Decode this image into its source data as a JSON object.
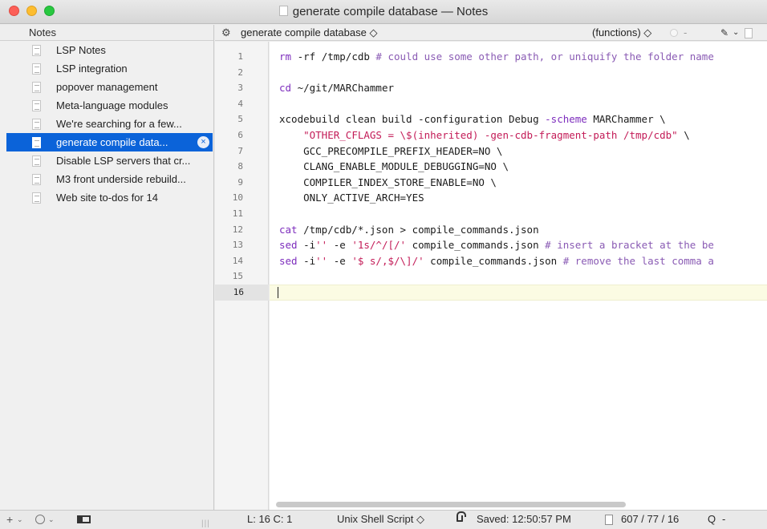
{
  "window": {
    "title": "generate compile database — Notes"
  },
  "sidebar": {
    "header": "Notes",
    "items": [
      {
        "label": "LSP Notes",
        "icon": "formatted-doc-icon"
      },
      {
        "label": "LSP integration",
        "icon": "document-icon"
      },
      {
        "label": "popover management",
        "icon": "document-icon"
      },
      {
        "label": "Meta-language modules",
        "icon": "document-icon"
      },
      {
        "label": "We're searching for a few...",
        "icon": "formatted-doc-icon"
      },
      {
        "label": "generate compile data...",
        "icon": "document-icon",
        "selected": true
      },
      {
        "label": "Disable LSP servers that cr...",
        "icon": "document-icon"
      },
      {
        "label": "M3 front underside rebuild...",
        "icon": "document-icon"
      },
      {
        "label": "Web site to-dos for 14",
        "icon": "document-icon"
      }
    ],
    "selected_clear_icon": "×"
  },
  "editor": {
    "header": {
      "document_menu": "generate compile database ◇",
      "functions_menu": "(functions) ◇",
      "dash": "-"
    },
    "line_numbers": [
      "1",
      "2",
      "3",
      "4",
      "5",
      "6",
      "7",
      "8",
      "9",
      "10",
      "11",
      "12",
      "13",
      "14",
      "15",
      "16"
    ],
    "current_line": 16,
    "code": [
      [
        {
          "t": "kw",
          "v": "rm"
        },
        {
          "t": "",
          "v": " -rf /tmp/cdb "
        },
        {
          "t": "cmt",
          "v": "# could use some other path, or uniquify the folder name"
        }
      ],
      [],
      [
        {
          "t": "kw",
          "v": "cd"
        },
        {
          "t": "",
          "v": " ~/git/MARChammer"
        }
      ],
      [],
      [
        {
          "t": "",
          "v": "xcodebuild clean build -configuration Debug "
        },
        {
          "t": "kw",
          "v": "-scheme"
        },
        {
          "t": "",
          "v": " MARChammer \\"
        }
      ],
      [
        {
          "t": "",
          "v": "    "
        },
        {
          "t": "str",
          "v": "\"OTHER_CFLAGS = \\$(inherited) -gen-cdb-fragment-path /tmp/cdb\""
        },
        {
          "t": "",
          "v": " \\"
        }
      ],
      [
        {
          "t": "",
          "v": "    GCC_PRECOMPILE_PREFIX_HEADER=NO \\"
        }
      ],
      [
        {
          "t": "",
          "v": "    CLANG_ENABLE_MODULE_DEBUGGING=NO \\"
        }
      ],
      [
        {
          "t": "",
          "v": "    COMPILER_INDEX_STORE_ENABLE=NO \\"
        }
      ],
      [
        {
          "t": "",
          "v": "    ONLY_ACTIVE_ARCH=YES"
        }
      ],
      [],
      [
        {
          "t": "kw",
          "v": "cat"
        },
        {
          "t": "",
          "v": " /tmp/cdb/*.json > compile_commands.json"
        }
      ],
      [
        {
          "t": "kw",
          "v": "sed"
        },
        {
          "t": "",
          "v": " -i"
        },
        {
          "t": "str",
          "v": "''"
        },
        {
          "t": "",
          "v": " -e "
        },
        {
          "t": "str",
          "v": "'1s/^/[/'"
        },
        {
          "t": "",
          "v": " compile_commands.json "
        },
        {
          "t": "cmt",
          "v": "# insert a bracket at the be"
        }
      ],
      [
        {
          "t": "kw",
          "v": "sed"
        },
        {
          "t": "",
          "v": " -i"
        },
        {
          "t": "str",
          "v": "''"
        },
        {
          "t": "",
          "v": " -e "
        },
        {
          "t": "str",
          "v": "'$ s/,$/\\]/'"
        },
        {
          "t": "",
          "v": " compile_commands.json "
        },
        {
          "t": "cmt",
          "v": "# remove the last comma a"
        }
      ],
      [],
      []
    ]
  },
  "status": {
    "position": "L: 16 C: 1",
    "language": "Unix Shell Script ◇",
    "saved": "Saved: 12:50:57 PM",
    "counts": "607 / 77 / 16",
    "search": "Q",
    "search_dash": "-",
    "grip": "|||"
  },
  "colors": {
    "selection": "#0b63d9",
    "keyword": "#7d2dbd",
    "string": "#c31b57",
    "comment": "#8a5bb4"
  }
}
